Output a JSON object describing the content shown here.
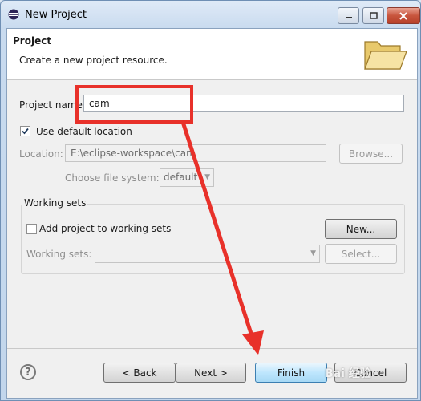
{
  "window": {
    "title": "New Project"
  },
  "header": {
    "title": "Project",
    "description": "Create a new project resource."
  },
  "form": {
    "project_name_label": "Project name:",
    "project_name_value": "cam",
    "use_default_location_label": "Use default location",
    "use_default_location_checked": true,
    "location_label": "Location:",
    "location_value": "E:\\eclipse-workspace\\cam",
    "browse_label": "Browse...",
    "file_system_label": "Choose file system:",
    "file_system_value": "default"
  },
  "working_sets": {
    "legend": "Working sets",
    "add_label": "Add project to working sets",
    "add_checked": false,
    "new_label": "New...",
    "sets_label": "Working sets:",
    "sets_value": "",
    "select_label": "Select..."
  },
  "footer": {
    "help_symbol": "?",
    "back_label": "< Back",
    "next_label": "Next >",
    "finish_label": "Finish",
    "cancel_label": "Cancel"
  },
  "annotation": {
    "color": "#e8312a"
  },
  "watermark": {
    "text": "Bai 经验"
  }
}
